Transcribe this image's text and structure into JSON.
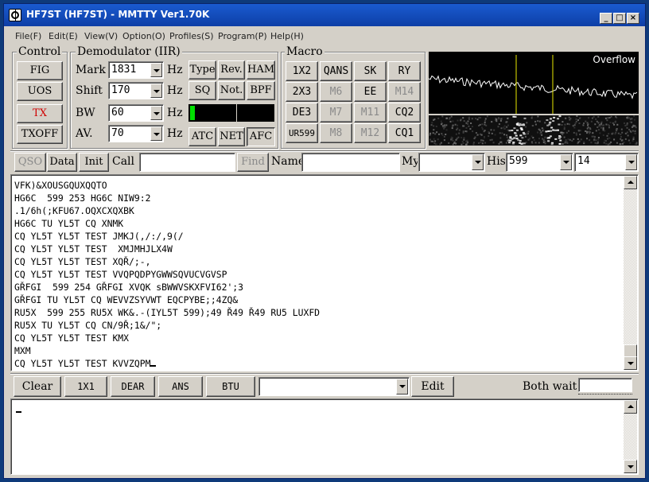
{
  "window": {
    "title": "HF7ST (HF7ST) - MMTTY Ver1.70K"
  },
  "menu": [
    "File(F)",
    "Edit(E)",
    "View(V)",
    "Option(O)",
    "Profiles(S)",
    "Program(P)",
    "Help(H)"
  ],
  "control": {
    "label": "Control",
    "buttons": [
      "FIG",
      "UOS",
      "TX",
      "TXOFF"
    ]
  },
  "demod": {
    "label": "Demodulator (IIR)",
    "rows": [
      {
        "label": "Mark",
        "value": "1831",
        "unit": "Hz"
      },
      {
        "label": "Shift",
        "value": "170",
        "unit": "Hz"
      },
      {
        "label": "BW",
        "value": "60",
        "unit": "Hz"
      },
      {
        "label": "AV.",
        "value": "70",
        "unit": "Hz"
      }
    ],
    "buttons": {
      "type": "Type",
      "rev": "Rev.",
      "ham": "HAM",
      "sq": "SQ",
      "not": "Not.",
      "bpf": "BPF",
      "atc": "ATC",
      "net": "NET",
      "afc": "AFC"
    },
    "level_fraction": 0.06,
    "level_color": "#00e000"
  },
  "macro": {
    "label": "Macro",
    "buttons": [
      [
        "1X2",
        "QANS",
        "SK",
        "RY"
      ],
      [
        "2X3",
        "M6",
        "EE",
        "M14"
      ],
      [
        "DE3",
        "M7",
        "M11",
        "CQ2"
      ],
      [
        "UR599",
        "M8",
        "M12",
        "CQ1"
      ]
    ]
  },
  "scope": {
    "overflow": "Overflow",
    "marker_color": "#e8e800"
  },
  "entry": {
    "qso": "QSO",
    "data": "Data",
    "init": "Init",
    "call_label": "Call",
    "call_value": "",
    "find": "Find",
    "name_label": "Name",
    "name_value": "",
    "my_label": "My",
    "my_value": "",
    "his_label": "His",
    "his_value": "599",
    "extra_value": "14"
  },
  "rx_text": [
    "VFK)&XOUSGQUXQQTO",
    "HG6C  599 253 HG6C NIW9:2",
    ".1/6h(;KFU67.OQXCXQXBK",
    "HG6C TU YL5T CQ XNMK",
    "CQ YL5T YL5T TEST JMKJ(,/:/,9(/",
    "CQ YL5T YL5T TEST  XMJMHJLX4W",
    "CQ YL5T YL5T TEST XQŘ/;-,",
    "CQ YL5T YL5T TEST VVQPQDPYGWWSQVUCVGVSP",
    "GŘFGI  599 254 GŘFGI XVQK sBWWVSKXFVI62';3",
    "GŘFGI TU YL5T CQ WEVVZSYVWT EQCPYBE;;4ZQ&",
    "RU5X  599 255 RU5X WK&.-(IYL5T 599);49 Ř49 Ř49 RU5 LUXFD",
    "RU5X TU YL5T CQ CN/9Ř;1&/\";",
    "CQ YL5T YL5T TEST KMX",
    "MXM",
    "CQ YL5T YL5T TEST KVVZQPM"
  ],
  "toolbar": {
    "clear": "Clear",
    "b1x1": "1X1",
    "dear": "DEAR",
    "ans": "ANS",
    "btu": "BTU",
    "combo_value": "",
    "edit": "Edit",
    "both_wait": "Both wait"
  },
  "tx_text": ""
}
